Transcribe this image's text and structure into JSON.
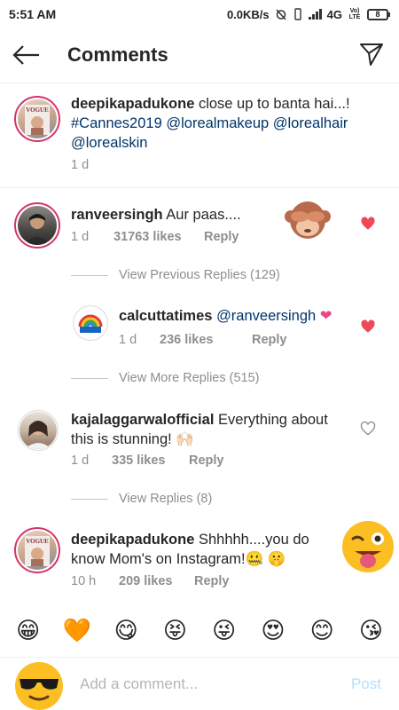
{
  "status_bar": {
    "time": "5:51 AM",
    "network_speed": "0.0KB/s",
    "network_type": "4G",
    "carrier_badge": "Vo) LTE",
    "battery": "8"
  },
  "header": {
    "title": "Comments"
  },
  "caption": {
    "username": "deepikapadukone",
    "text": " close up to banta hai...! ",
    "hashtag": "#Cannes2019",
    "mention1": "@lorealmakeup",
    "mention2": "@lorealhair",
    "mention3": "@lorealskin",
    "time": "1 d"
  },
  "comments": [
    {
      "username": "ranveersingh",
      "text": " Aur paas....",
      "time": "1 d",
      "likes": "31763 likes",
      "reply": "Reply",
      "liked": true
    },
    {
      "username": "calcuttatimes",
      "mention": "@ranveersingh",
      "text": "",
      "time": "1 d",
      "likes": "236 likes",
      "reply": "Reply",
      "liked": true,
      "avatar_label": "Calcutta times"
    },
    {
      "username": "kajalaggarwalofficial",
      "text": " Everything about this is stunning! 🙌🏻",
      "time": "1 d",
      "likes": "335 likes",
      "reply": "Reply",
      "liked": false
    },
    {
      "username": "deepikapadukone",
      "text": " Shhhhh....you do know Mom's on Instagram!🤐 🤫",
      "time": "10 h",
      "likes": "209 likes",
      "reply": "Reply",
      "liked": false
    }
  ],
  "replies_links": {
    "previous": "View Previous Replies (129)",
    "more": "View More Replies (515)",
    "replies": "View Replies (8)"
  },
  "emoji_bar": [
    "😁",
    "🧡",
    "😋",
    "😝",
    "😜",
    "😍",
    "😊",
    "😘"
  ],
  "compose": {
    "placeholder": "Add a comment...",
    "post_label": "Post"
  },
  "colors": {
    "heart": "#ed4956",
    "link": "#003569",
    "meta": "#8e8e8e",
    "post": "#b2dffc"
  }
}
